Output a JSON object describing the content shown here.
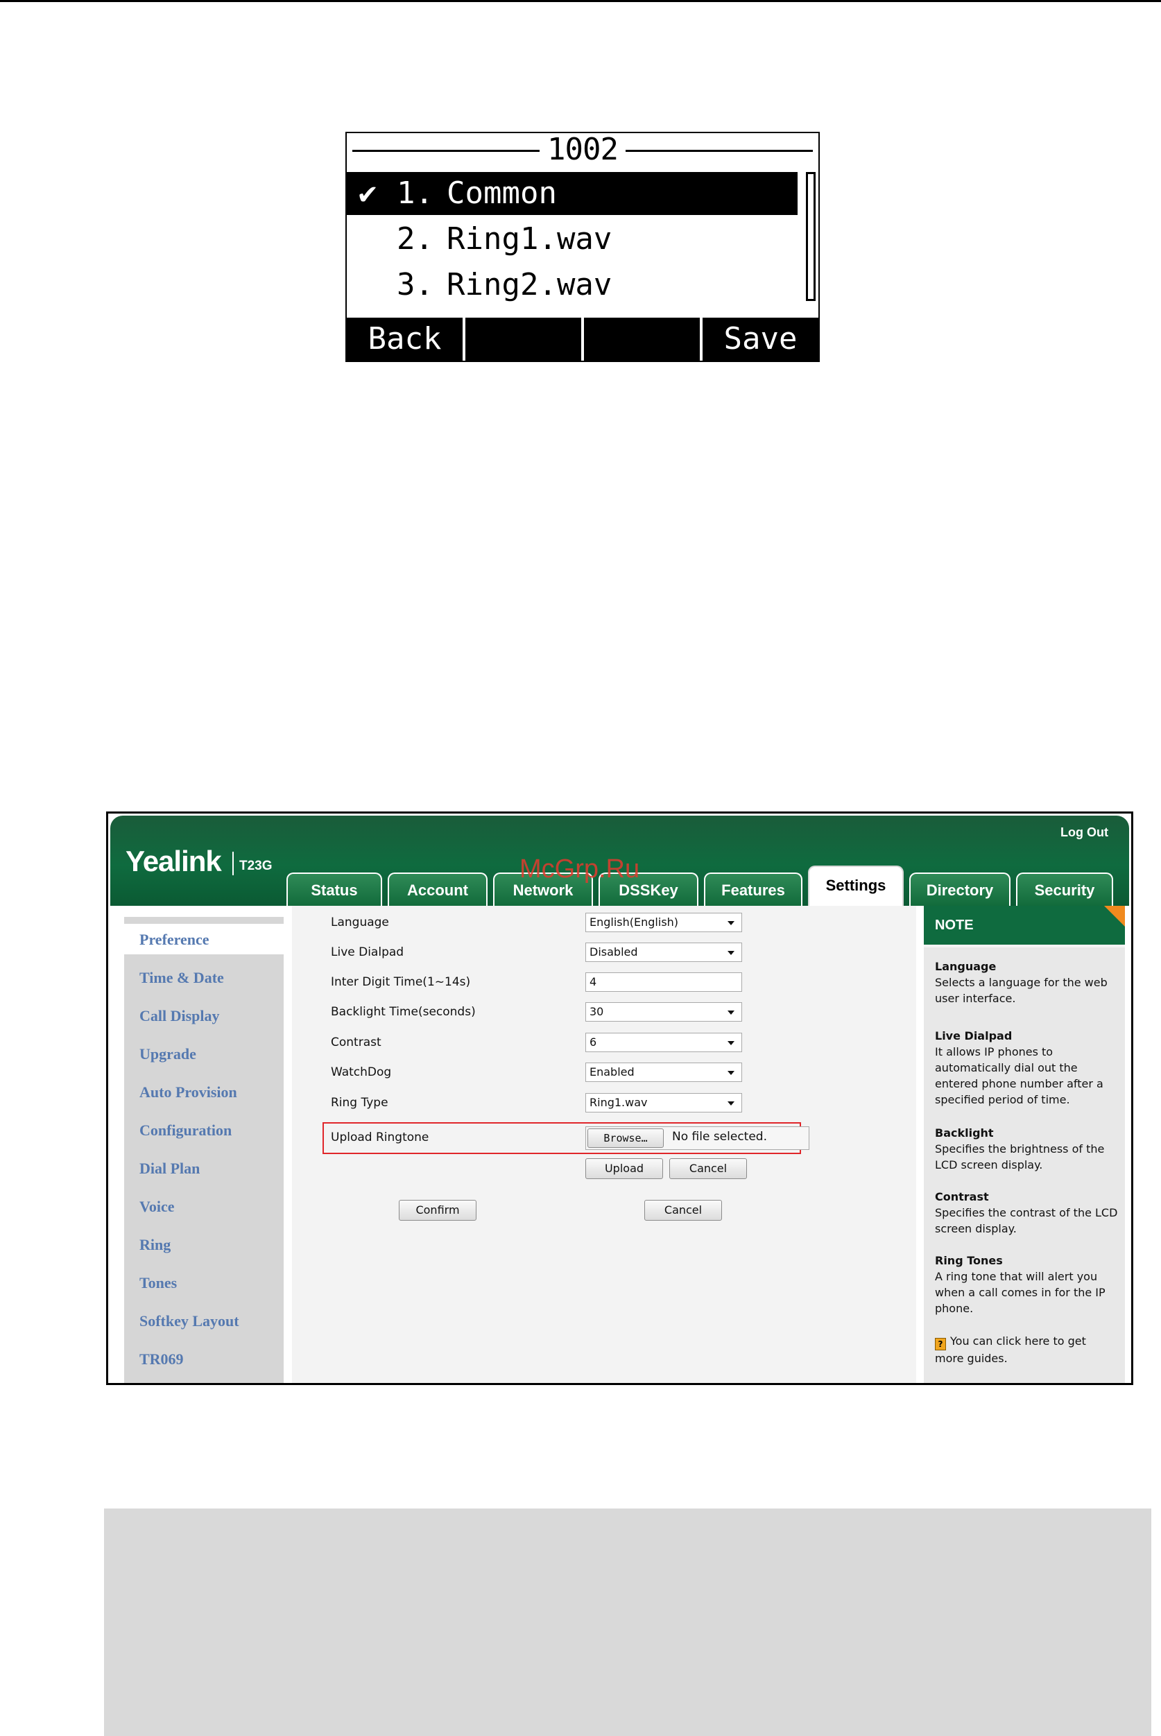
{
  "lcd": {
    "title": "1002",
    "items": [
      {
        "check": "✔",
        "num": "1.",
        "name": "Common",
        "selected": true
      },
      {
        "check": "",
        "num": "2.",
        "name": "Ring1.wav",
        "selected": false
      },
      {
        "check": "",
        "num": "3.",
        "name": "Ring2.wav",
        "selected": false
      }
    ],
    "softkeys": [
      "Back",
      "",
      "",
      "Save"
    ]
  },
  "web": {
    "brand": "Yealink",
    "model": "T23G",
    "logout": "Log Out",
    "watermark": "McGrp.Ru",
    "tabs": [
      "Status",
      "Account",
      "Network",
      "DSSKey",
      "Features",
      "Settings",
      "Directory",
      "Security"
    ],
    "active_tab": "Settings",
    "sidebar": [
      "Preference",
      "Time & Date",
      "Call Display",
      "Upgrade",
      "Auto Provision",
      "Configuration",
      "Dial Plan",
      "Voice",
      "Ring",
      "Tones",
      "Softkey Layout",
      "TR069"
    ],
    "fields": {
      "language": {
        "label": "Language",
        "value": "English(English)"
      },
      "live_dialpad": {
        "label": "Live Dialpad",
        "value": "Disabled"
      },
      "inter_digit": {
        "label": "Inter Digit Time(1~14s)",
        "value": "4"
      },
      "backlight": {
        "label": "Backlight Time(seconds)",
        "value": "30"
      },
      "contrast": {
        "label": "Contrast",
        "value": "6"
      },
      "watchdog": {
        "label": "WatchDog",
        "value": "Enabled"
      },
      "ring_type": {
        "label": "Ring Type",
        "value": "Ring1.wav"
      },
      "upload_ringtone": {
        "label": "Upload Ringtone",
        "browse": "Browse…",
        "status": "No file selected."
      }
    },
    "buttons": {
      "upload": "Upload",
      "cancel_upload": "Cancel",
      "confirm": "Confirm",
      "cancel": "Cancel"
    },
    "note": {
      "title": "NOTE",
      "items": [
        {
          "title": "Language",
          "text": "Selects a language for the web user interface."
        },
        {
          "title": "Live Dialpad",
          "text": "It allows IP phones to automatically dial out the entered phone number after a specified period of time."
        },
        {
          "title": "Backlight",
          "text": "Specifies the brightness of the LCD screen display."
        },
        {
          "title": "Contrast",
          "text": "Specifies the contrast of the LCD screen display."
        },
        {
          "title": "Ring Tones",
          "text": "A ring tone that will alert you when a call comes in for the IP phone."
        }
      ],
      "guide_icon_glyph": "?",
      "guide": "You can click here to get more guides."
    }
  }
}
